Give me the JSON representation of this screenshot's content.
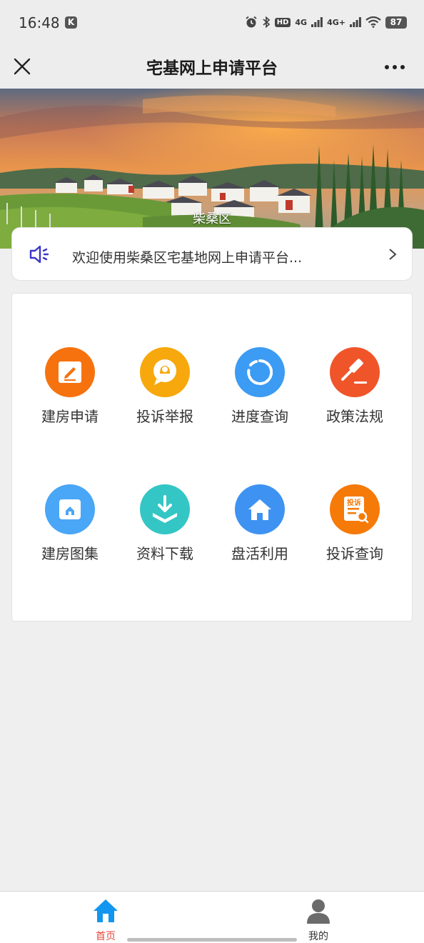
{
  "status_bar": {
    "time": "16:48",
    "k_badge": "K",
    "network1": "4G",
    "network2": "4G+",
    "hd": "HD",
    "battery": "87"
  },
  "navbar": {
    "title": "宅基网上申请平台",
    "close_icon": "close-icon",
    "more_icon": "more-icon"
  },
  "banner": {
    "label": "柴桑区"
  },
  "notice": {
    "text": "欢迎使用柴桑区宅基地网上申请平台...",
    "icon": "speaker-icon",
    "accent": "#3b35c8"
  },
  "grid": {
    "items": [
      {
        "label": "建房申请",
        "icon": "edit-icon",
        "color": "#f6720f"
      },
      {
        "label": "投诉举报",
        "icon": "complaint-icon",
        "color": "#f7a80c"
      },
      {
        "label": "进度查询",
        "icon": "progress-icon",
        "color": "#3c9bf3"
      },
      {
        "label": "政策法规",
        "icon": "gavel-icon",
        "color": "#f0552a"
      },
      {
        "label": "建房图集",
        "icon": "album-icon",
        "color": "#4aa6f6"
      },
      {
        "label": "资料下载",
        "icon": "download-icon",
        "color": "#34c6c4"
      },
      {
        "label": "盘活利用",
        "icon": "house-icon",
        "color": "#3e93f2"
      },
      {
        "label": "投诉查询",
        "icon": "complaint-search-icon",
        "color": "#f67a08",
        "badge": "投诉"
      }
    ]
  },
  "tabbar": {
    "home_label": "首页",
    "mine_label": "我的",
    "active_color": "#1296f0",
    "active_label_color": "#e8473a"
  }
}
